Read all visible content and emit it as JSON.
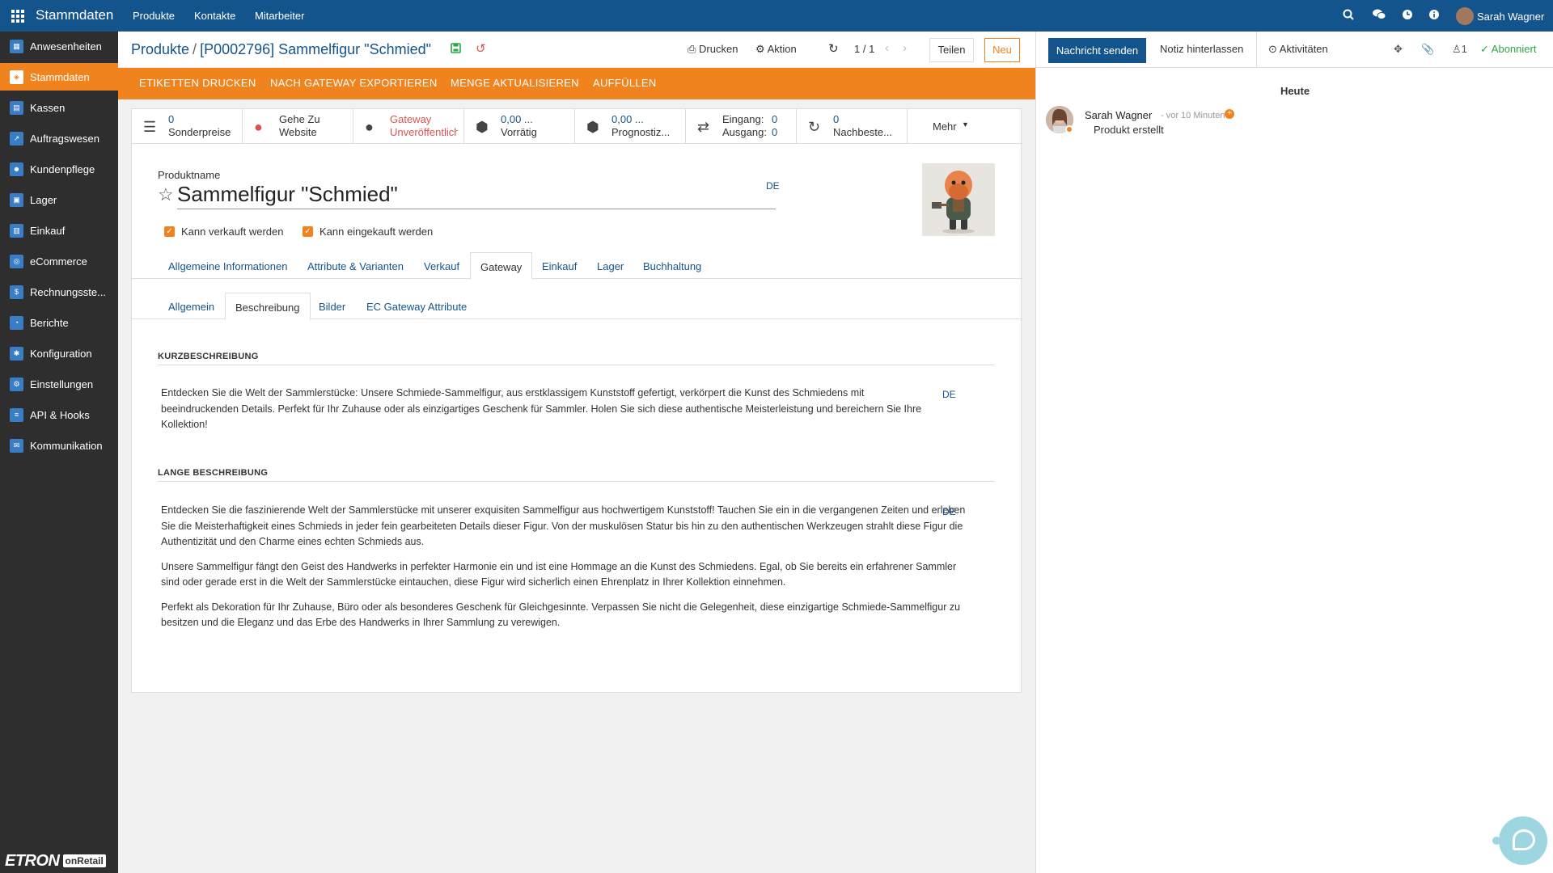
{
  "topbar": {
    "app_name": "Stammdaten",
    "menu": [
      "Produkte",
      "Kontakte",
      "Mitarbeiter"
    ],
    "icons": [
      "search-icon",
      "chat-icon",
      "clock-icon",
      "info-icon"
    ],
    "user": "Sarah Wagner"
  },
  "sidebar": {
    "items": [
      {
        "label": "Anwesenheiten",
        "icon": "attendance-icon"
      },
      {
        "label": "Stammdaten",
        "icon": "master-data-icon",
        "active": true
      },
      {
        "label": "Kassen",
        "icon": "pos-icon"
      },
      {
        "label": "Auftragswesen",
        "icon": "orders-icon"
      },
      {
        "label": "Kundenpflege",
        "icon": "crm-icon"
      },
      {
        "label": "Lager",
        "icon": "warehouse-icon"
      },
      {
        "label": "Einkauf",
        "icon": "purchase-icon"
      },
      {
        "label": "eCommerce",
        "icon": "ecommerce-icon"
      },
      {
        "label": "Rechnungsste...",
        "icon": "invoice-icon"
      },
      {
        "label": "Berichte",
        "icon": "reports-icon"
      },
      {
        "label": "Konfiguration",
        "icon": "config-icon"
      },
      {
        "label": "Einstellungen",
        "icon": "settings-icon"
      },
      {
        "label": "API & Hooks",
        "icon": "api-icon"
      },
      {
        "label": "Kommunikation",
        "icon": "communication-icon"
      }
    ],
    "logo_main": "ETRON",
    "logo_sub": "onRetail"
  },
  "breadcrumb": {
    "parent": "Produkte",
    "separator": "/",
    "current": "[P0002796] Sammelfigur \"Schmied\""
  },
  "header_actions": {
    "print": "Drucken",
    "action": "Aktion",
    "pager": "1 / 1",
    "share": "Teilen",
    "new": "Neu"
  },
  "action_bar": [
    "ETIKETTEN DRUCKEN",
    "NACH GATEWAY EXPORTIEREN",
    "MENGE AKTUALISIEREN",
    "AUFFÜLLEN"
  ],
  "stat_buttons": [
    {
      "line1": "0",
      "line2": "Sonderpreise",
      "icon": "list-icon"
    },
    {
      "line1": "Gehe Zu",
      "line2": "Website",
      "icon": "globe-icon"
    },
    {
      "line1": "Gateway",
      "line2": "Unveröffentlicht",
      "icon": "globe-icon"
    },
    {
      "line1": "0,00 ...",
      "line2": "Vorrätig",
      "icon": "cubes-icon"
    },
    {
      "line1": "0,00 ...",
      "line2": "Prognostiz...",
      "icon": "cubes-icon"
    },
    {
      "line1": "Eingang:",
      "line1_val": "0",
      "line2": "Ausgang:",
      "line2_val": "0",
      "icon": "exchange-icon"
    },
    {
      "line1": "0",
      "line2": "Nachbeste...",
      "icon": "refresh-icon"
    },
    {
      "line1": "Mehr",
      "icon": "caret-down-icon"
    }
  ],
  "form": {
    "product_name_label": "Produktname",
    "product_name": "Sammelfigur \"Schmied\"",
    "lang": "DE",
    "can_be_sold": "Kann verkauft werden",
    "can_be_purchased": "Kann eingekauft werden"
  },
  "tabs": [
    "Allgemeine Informationen",
    "Attribute & Varianten",
    "Verkauf",
    "Gateway",
    "Einkauf",
    "Lager",
    "Buchhaltung"
  ],
  "active_tab": "Gateway",
  "subtabs": [
    "Allgemein",
    "Beschreibung",
    "Bilder",
    "EC Gateway Attribute"
  ],
  "active_subtab": "Beschreibung",
  "short_description": {
    "heading": "KURZBESCHREIBUNG",
    "text": "Entdecken Sie die Welt der Sammlerstücke: Unsere Schmiede-Sammelfigur, aus erstklassigem Kunststoff gefertigt, verkörpert die Kunst des Schmiedens mit beeindruckenden Details. Perfekt für Ihr Zuhause oder als einzigartiges Geschenk für Sammler. Holen Sie sich diese authentische Meisterleistung und bereichern Sie Ihre Kollektion!",
    "lang": "DE"
  },
  "long_description": {
    "heading": "LANGE BESCHREIBUNG",
    "paragraphs": [
      "Entdecken Sie die faszinierende Welt der Sammlerstücke mit unserer exquisiten Sammelfigur aus hochwertigem Kunststoff! Tauchen Sie ein in die vergangenen Zeiten und erleben Sie die Meisterhaftigkeit eines Schmieds in jeder fein gearbeiteten Details dieser Figur. Von der muskulösen Statur bis hin zu den authentischen Werkzeugen strahlt diese Figur die Authentizität und den Charme eines echten Schmieds aus.",
      "Unsere Sammelfigur fängt den Geist des Handwerks in perfekter Harmonie ein und ist eine Hommage an die Kunst des Schmiedens. Egal, ob Sie bereits ein erfahrener Sammler sind oder gerade erst in die Welt der Sammlerstücke eintauchen, diese Figur wird sicherlich einen Ehrenplatz in Ihrer Kollektion einnehmen.",
      "Perfekt als Dekoration für Ihr Zuhause, Büro oder als besonderes Geschenk für Gleichgesinnte. Verpassen Sie nicht die Gelegenheit, diese einzigartige Schmiede-Sammelfigur zu besitzen und die Eleganz und das Erbe des Handwerks in Ihrer Sammlung zu verewigen."
    ],
    "lang": "DE"
  },
  "chatter": {
    "send_message": "Nachricht senden",
    "log_note": "Notiz hinterlassen",
    "activities": "Aktivitäten",
    "followers_count": "1",
    "subscribed": "Abonniert",
    "date_separator": "Heute",
    "message": {
      "author": "Sarah Wagner",
      "time": "- vor 10 Minuten",
      "body": "Produkt erstellt"
    }
  },
  "colors": {
    "primary": "#14548c",
    "accent": "#f1831f",
    "sidebar": "#2e2e2e",
    "success": "#28a745"
  }
}
